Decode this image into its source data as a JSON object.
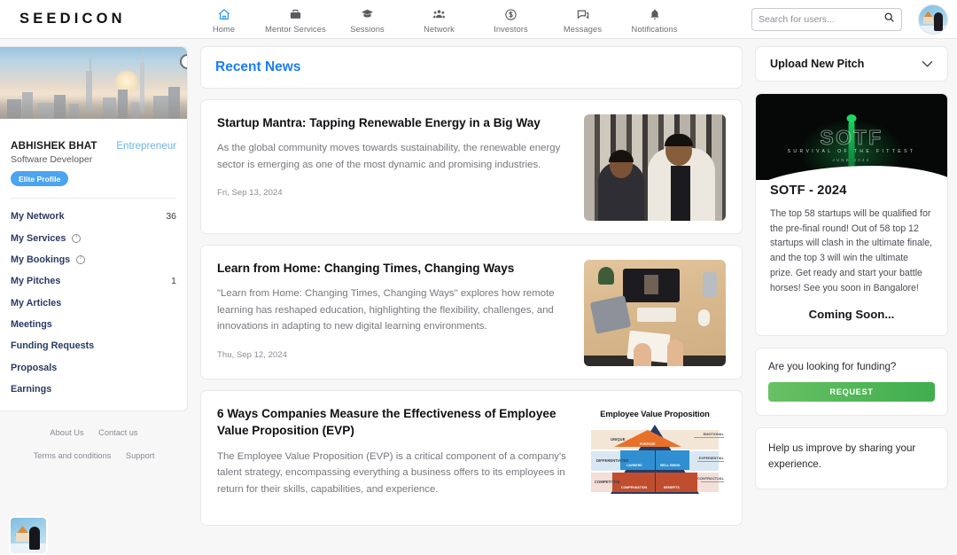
{
  "brand": "SEEDICON",
  "nav": {
    "items": [
      {
        "label": "Home",
        "icon": "home-icon",
        "active": true
      },
      {
        "label": "Mentor Services",
        "icon": "briefcase-icon",
        "active": false
      },
      {
        "label": "Sessions",
        "icon": "graduation-cap-icon",
        "active": false
      },
      {
        "label": "Network",
        "icon": "people-icon",
        "active": false
      },
      {
        "label": "Investors",
        "icon": "dollar-circle-icon",
        "active": false
      },
      {
        "label": "Messages",
        "icon": "chat-icon",
        "active": false
      },
      {
        "label": "Notifications",
        "icon": "bell-icon",
        "active": false
      }
    ],
    "search_placeholder": "Search for users...",
    "search_value": ""
  },
  "profile": {
    "name": "ABHISHEK BHAT",
    "role_tag": "Entrepreneur",
    "subtitle": "Software Developer",
    "badge": "Elite Profile",
    "menu": [
      {
        "label": "My Network",
        "count": "36",
        "info": false
      },
      {
        "label": "My Services",
        "count": "",
        "info": true
      },
      {
        "label": "My Bookings",
        "count": "",
        "info": true
      },
      {
        "label": "My Pitches",
        "count": "1",
        "info": false
      },
      {
        "label": "My Articles",
        "count": "",
        "info": false
      },
      {
        "label": "Meetings",
        "count": "",
        "info": false
      },
      {
        "label": "Funding Requests",
        "count": "",
        "info": false
      },
      {
        "label": "Proposals",
        "count": "",
        "info": false
      },
      {
        "label": "Earnings",
        "count": "",
        "info": false
      }
    ],
    "footer_links_row1": [
      {
        "label": "About Us"
      },
      {
        "label": "Contact us"
      }
    ],
    "footer_links_row2": [
      {
        "label": "Terms and conditions"
      },
      {
        "label": "Support"
      }
    ]
  },
  "main": {
    "section_title": "Recent News",
    "articles": [
      {
        "title": "Startup Mantra: Tapping Renewable Energy in a Big Way",
        "description": "As the global community moves towards sustainability, the renewable energy sector is emerging as one of the most dynamic and promising industries.",
        "date": "Fri, Sep 13, 2024",
        "image": "two-men-photo"
      },
      {
        "title": "Learn from Home: Changing Times, Changing Ways",
        "description": "\"Learn from Home: Changing Times, Changing Ways\" explores how remote learning has reshaped education, highlighting the flexibility, challenges, and innovations in adapting to new digital learning environments.",
        "date": "Thu, Sep 12, 2024",
        "image": "desk-flatlay-photo"
      },
      {
        "title": "6 Ways Companies Measure the Effectiveness of Employee Value Proposition (EVP)",
        "description": "The Employee Value Proposition (EVP) is a critical component of a company's talent strategy, encompassing everything a business offers to its employees in return for their skills, capabilities, and experience.",
        "date": "",
        "image": "evp-pyramid-diagram"
      }
    ]
  },
  "evp_diagram": {
    "title": "Employee Value Proposition",
    "bands": [
      "UNIQUE",
      "DIFFERENTIATED",
      "COMPETITIVE"
    ],
    "cells": [
      "PURPOSE",
      "CAREERS",
      "WELL BEING",
      "COMPENSATION",
      "BENEFITS"
    ],
    "leaders": [
      "EMOTIONAL",
      "EXPERIENTIAL",
      "CONTRACTUAL"
    ]
  },
  "right": {
    "upload_pitch": "Upload New Pitch",
    "sotf_banner": {
      "logo": "SOTF",
      "tagline": "SURVIVAL OF THE FITTEST",
      "date": "JUNE 2024"
    },
    "sotf_title": "SOTF - 2024",
    "sotf_text": "The top 58 startups will be qualified for the pre-final round! Out of 58 top 12 startups will clash in the ultimate finale, and the top 3 will win the ultimate prize. Get ready and start your battle horses! See you soon in Bangalore!",
    "coming_soon": "Coming Soon...",
    "funding_question": "Are you looking for funding?",
    "request_button": "REQUEST",
    "feedback_text": "Help us improve by sharing your experience."
  },
  "colors": {
    "accent_blue": "#1a7df0",
    "role_blue": "#6cb4e8",
    "badge_blue": "#4ca3f0",
    "menu_navy": "#2b3a63",
    "request_green": "#3fae4e",
    "page_bg": "#f7f7f8"
  }
}
